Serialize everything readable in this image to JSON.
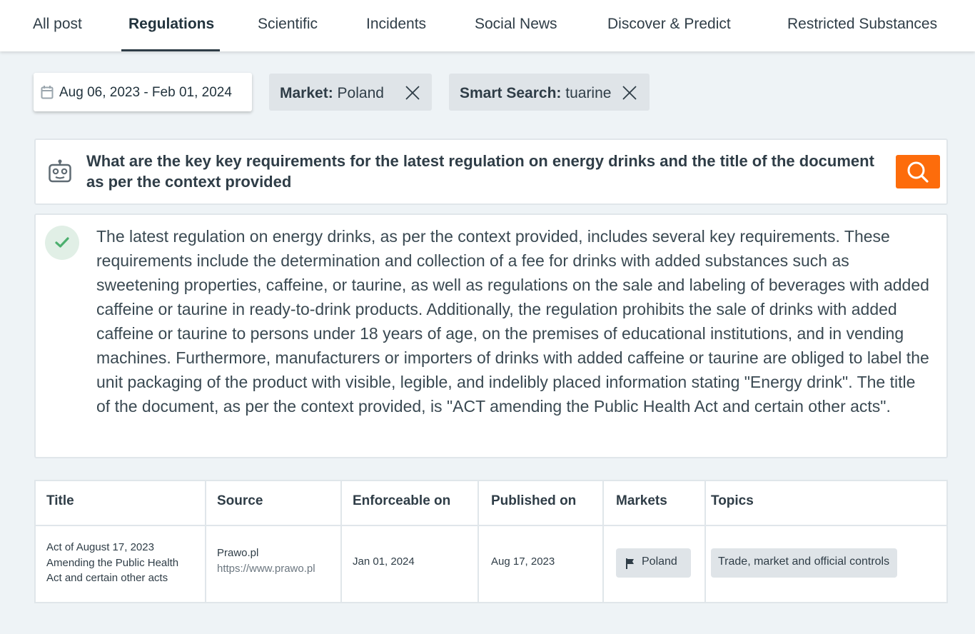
{
  "tabs": [
    "All post",
    "Regulations",
    "Scientific",
    "Incidents",
    "Social News",
    "Discover & Predict",
    "Restricted Substances"
  ],
  "filters": {
    "date_range": "Aug 06, 2023 - Feb 01, 2024",
    "market_label": "Market:",
    "market_value": "Poland",
    "smart_search_label": "Smart Search:",
    "smart_search_value": "tuarine"
  },
  "query": {
    "text": "What are the key key requirements for the latest regulation on energy drinks and the title of the document as per the context provided"
  },
  "answer": {
    "text": "The latest regulation on energy drinks, as per the context provided, includes several key requirements. These requirements include the determination and collection of a fee for drinks with added substances such as sweetening properties, caffeine, or taurine, as well as regulations on the sale and labeling of beverages with added caffeine or taurine in ready-to-drink products. Additionally, the regulation prohibits the sale of drinks with added caffeine or taurine to persons under 18 years of age, on the premises of educational institutions, and in vending machines. Furthermore, manufacturers or importers of drinks with added caffeine or taurine are obliged to label the unit packaging of the product with visible, legible, and indelibly placed information stating \"Energy drink\". The title of the document, as per the context provided, is \"ACT amending the Public Health Act and certain other acts\"."
  },
  "table": {
    "headers": [
      "Title",
      "Source",
      "Enforceable on",
      "Published on",
      "Markets",
      "Topics"
    ],
    "rows": [
      {
        "title": "Act of August 17, 2023 Amending the Public Health Act and certain other acts",
        "source_name": "Prawo.pl",
        "source_url": "https://www.prawo.pl",
        "enforceable_on": "Jan 01, 2024",
        "published_on": "Aug 17, 2023",
        "market": "Poland",
        "topic": "Trade, market and official controls"
      }
    ]
  },
  "colors": {
    "accent": "#fd6c0b",
    "background": "#eef3f6",
    "text": "#2f3d47",
    "success_bg": "#e1efe6",
    "success": "#4caf6e",
    "chip_bg": "#dfe4e8"
  },
  "icons": [
    "calendar-icon",
    "close-icon",
    "robot-icon",
    "search-icon",
    "check-icon",
    "flag-icon"
  ]
}
